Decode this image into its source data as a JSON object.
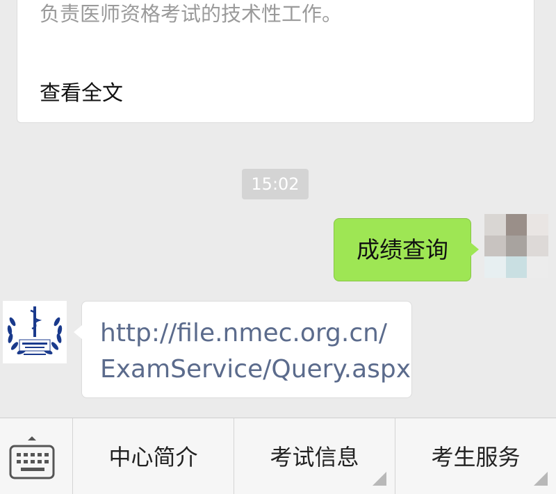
{
  "article": {
    "excerpt": "负责医师资格考试的技术性工作。",
    "read_more": "查看全文"
  },
  "timestamp": "15:02",
  "outgoing": {
    "text": "成绩查询"
  },
  "incoming": {
    "line1": "http://file.nmec.org.cn/",
    "line2": "ExamService/Query.aspx"
  },
  "menu": {
    "keyboard_icon": "keyboard-icon",
    "items": [
      {
        "label": "中心简介"
      },
      {
        "label": "考试信息"
      },
      {
        "label": "考生服务"
      }
    ]
  },
  "colors": {
    "background": "#ebebeb",
    "outgoing_bubble": "#9ee654",
    "link_text": "#5b6b8c",
    "logo_blue": "#1a3a8c"
  }
}
